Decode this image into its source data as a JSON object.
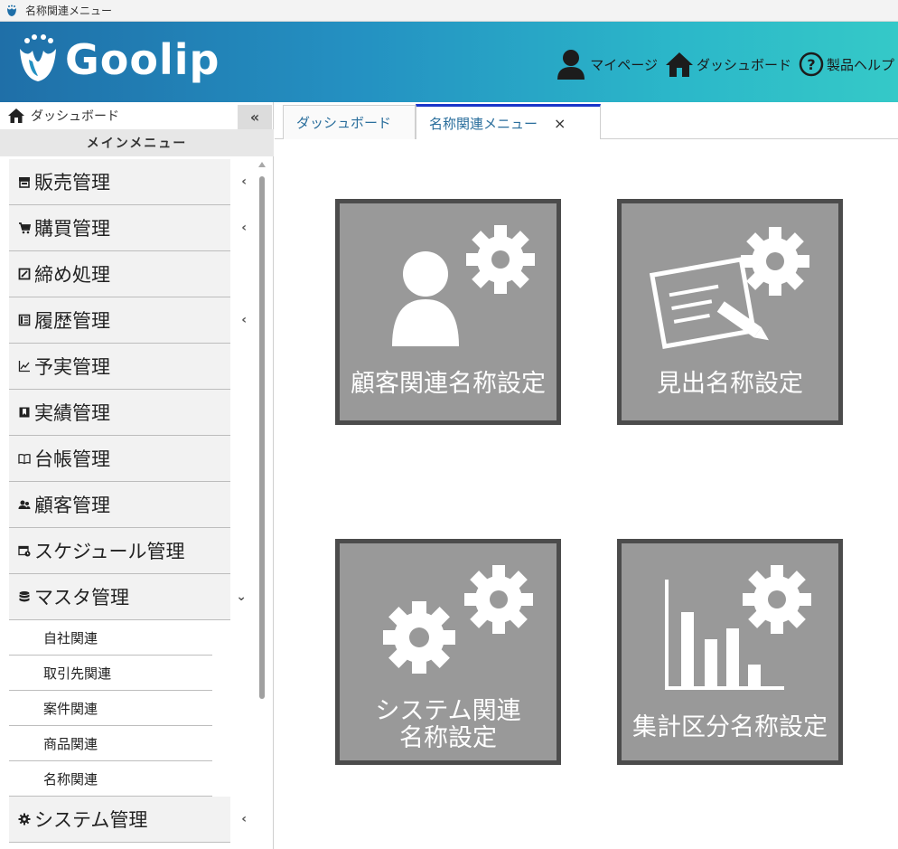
{
  "window": {
    "title": "名称関連メニュー"
  },
  "header": {
    "logo_text": "Goolip",
    "nav": {
      "mypage": "マイページ",
      "dashboard": "ダッシュボード",
      "help": "製品ヘルプ"
    },
    "colors": {
      "gradient_start": "#1f6fa8",
      "gradient_end": "#35c9c8"
    }
  },
  "sidebar": {
    "dashboard_link": "ダッシュボード",
    "collapse_label": "«",
    "main_menu_title": "メインメニュー",
    "items": [
      {
        "label": "販売管理",
        "icon": "store-icon",
        "caret": "‹"
      },
      {
        "label": "購買管理",
        "icon": "cart-icon",
        "caret": "‹"
      },
      {
        "label": "締め処理",
        "icon": "edit-square-icon",
        "caret": ""
      },
      {
        "label": "履歴管理",
        "icon": "list-icon",
        "caret": "‹"
      },
      {
        "label": "予実管理",
        "icon": "line-chart-icon",
        "caret": ""
      },
      {
        "label": "実績管理",
        "icon": "bookmark-icon",
        "caret": ""
      },
      {
        "label": "台帳管理",
        "icon": "book-icon",
        "caret": ""
      },
      {
        "label": "顧客管理",
        "icon": "users-icon",
        "caret": ""
      },
      {
        "label": "スケジュール管理",
        "icon": "calendar-icon",
        "caret": ""
      },
      {
        "label": "マスタ管理",
        "icon": "database-icon",
        "caret": "⌄"
      }
    ],
    "sub_items": [
      "自社関連",
      "取引先関連",
      "案件関連",
      "商品関連",
      "名称関連"
    ],
    "last_item": {
      "label": "システム管理",
      "icon": "gear-icon",
      "caret": "‹"
    }
  },
  "tabs": [
    {
      "label": "ダッシュボード",
      "active": false
    },
    {
      "label": "名称関連メニュー",
      "active": true,
      "close": "×"
    }
  ],
  "tiles": [
    {
      "label": "顧客関連名称設定",
      "icon": "user-gear-icon"
    },
    {
      "label": "見出名称設定",
      "icon": "document-pencil-gear-icon"
    },
    {
      "label_line1": "システム関連",
      "label_line2": "名称設定",
      "icon": "gears-icon"
    },
    {
      "label": "集計区分名称設定",
      "icon": "bar-chart-gear-icon"
    }
  ],
  "tile_colors": {
    "fill": "#999999",
    "border": "#4c4c4c"
  }
}
